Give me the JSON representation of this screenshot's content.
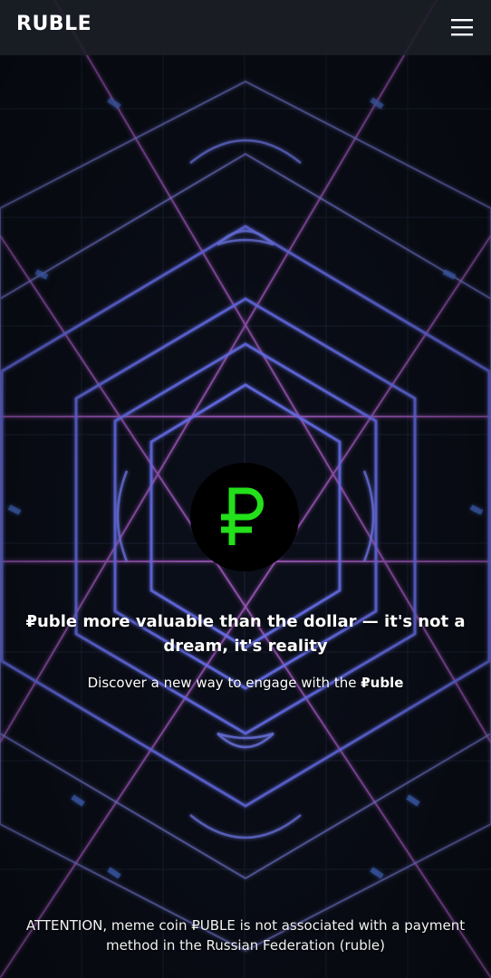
{
  "header": {
    "brand": "RUBLE",
    "menu_icon": "hamburger-menu-icon"
  },
  "hero": {
    "logo_icon": "ruble-sign-icon",
    "logo_color": "#22e01a",
    "headline_brand": "₽uble",
    "headline_rest": " more valuable than the dollar — it's not a dream, it's reality",
    "subtitle_prefix": "Discover a new way to engage with the ",
    "subtitle_brand": "₽uble"
  },
  "footer": {
    "attention": "ATTENTION, meme coin ₽UBLE is not associated with a payment method in the Russian Federation (ruble)"
  },
  "colors": {
    "background": "#0b0f1a",
    "header_bg": "#1c1f26",
    "pattern_blue": "#6f78ff",
    "pattern_violet": "#b060d0"
  }
}
